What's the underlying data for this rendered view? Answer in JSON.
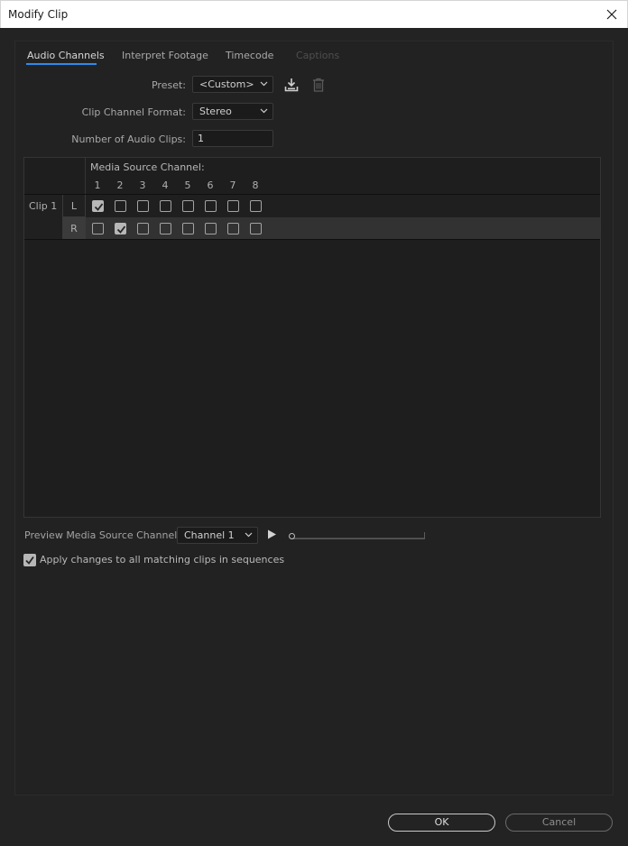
{
  "window": {
    "title": "Modify Clip"
  },
  "tabs": [
    {
      "label": "Audio Channels",
      "state": "active"
    },
    {
      "label": "Interpret Footage",
      "state": "normal"
    },
    {
      "label": "Timecode",
      "state": "normal"
    },
    {
      "label": "Captions",
      "state": "disabled"
    }
  ],
  "preset": {
    "label": "Preset:",
    "value": "<Custom>"
  },
  "format": {
    "label": "Clip Channel Format:",
    "value": "Stereo"
  },
  "num_clips": {
    "label": "Number of Audio Clips:",
    "value": "1"
  },
  "grid": {
    "header": "Media Source Channel:",
    "columns": [
      "1",
      "2",
      "3",
      "4",
      "5",
      "6",
      "7",
      "8"
    ],
    "clip_label": "Clip 1",
    "rows": [
      {
        "channel": "L",
        "checked": [
          true,
          false,
          false,
          false,
          false,
          false,
          false,
          false
        ]
      },
      {
        "channel": "R",
        "checked": [
          false,
          true,
          false,
          false,
          false,
          false,
          false,
          false
        ]
      }
    ]
  },
  "preview": {
    "label": "Preview Media Source Channel:",
    "value": "Channel 1",
    "position": 0
  },
  "apply": {
    "label": "Apply changes to all matching clips in sequences",
    "checked": true
  },
  "buttons": {
    "ok": "OK",
    "cancel": "Cancel"
  },
  "colors": {
    "accent": "#2d8ceb",
    "background": "#232323",
    "titlebar": "#ffffff"
  }
}
